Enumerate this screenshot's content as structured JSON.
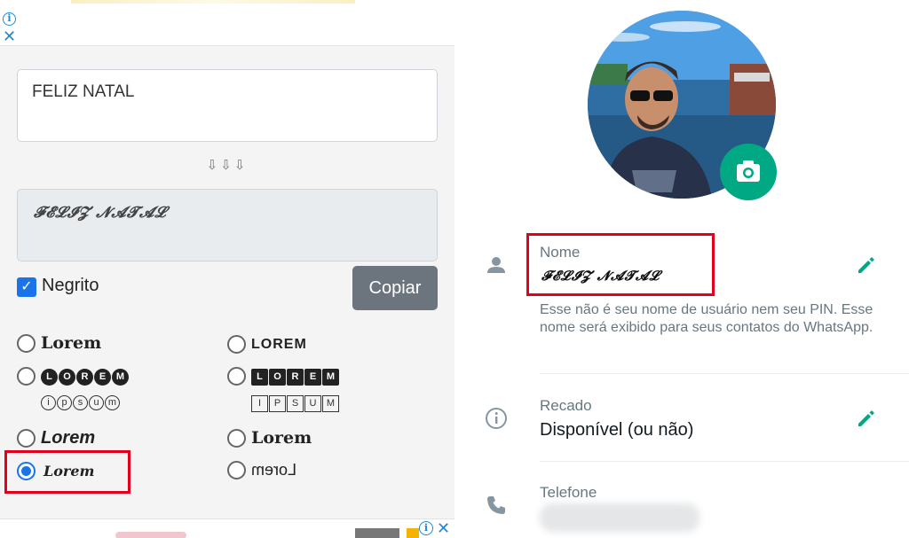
{
  "left_panel": {
    "input_text": "FELIZ NATAL",
    "arrows": "⇩⇩⇩",
    "output_text": "𝓕𝓔𝓛𝓘𝓩 𝓝𝓐𝓣𝓐𝓛",
    "bold_checkbox_label": "Negrito",
    "bold_checked": true,
    "copy_button_label": "Copiar",
    "options": [
      {
        "text": "Lorem",
        "style": "serif-bold",
        "selected": false
      },
      {
        "text": "LOREM",
        "style": "sans-bold",
        "selected": false
      },
      {
        "text": "LOREM",
        "subtext": "ipsum",
        "style": "circled",
        "selected": false
      },
      {
        "text": "LOREM",
        "subtext": "IPSUM",
        "style": "squared",
        "selected": false
      },
      {
        "text": "Lorem",
        "style": "bold-italic",
        "selected": false
      },
      {
        "text": "Lorem",
        "style": "fraktur",
        "selected": false
      },
      {
        "text": "Lorem",
        "style": "script",
        "selected": true
      },
      {
        "text": "Lorem",
        "style": "mirrored",
        "selected": false
      }
    ]
  },
  "right_panel": {
    "name_label": "Nome",
    "name_value": "𝓕𝓔𝓛𝓘𝓩 𝓝𝓐𝓣𝓐𝓛",
    "name_hint": "Esse não é seu nome de usuário nem seu PIN. Esse nome será exibido para seus contatos do WhatsApp.",
    "about_label": "Recado",
    "about_value": "Disponível (ou não)",
    "phone_label": "Telefone"
  },
  "colors": {
    "accent_green": "#00a884",
    "selection_blue": "#1a73e8",
    "highlight_red": "#e3001b",
    "copy_button": "#6c757d"
  },
  "icons": [
    "info-icon",
    "close-icon",
    "camera-icon",
    "person-icon",
    "edit-pencil-icon",
    "info-circle-icon",
    "phone-icon"
  ]
}
